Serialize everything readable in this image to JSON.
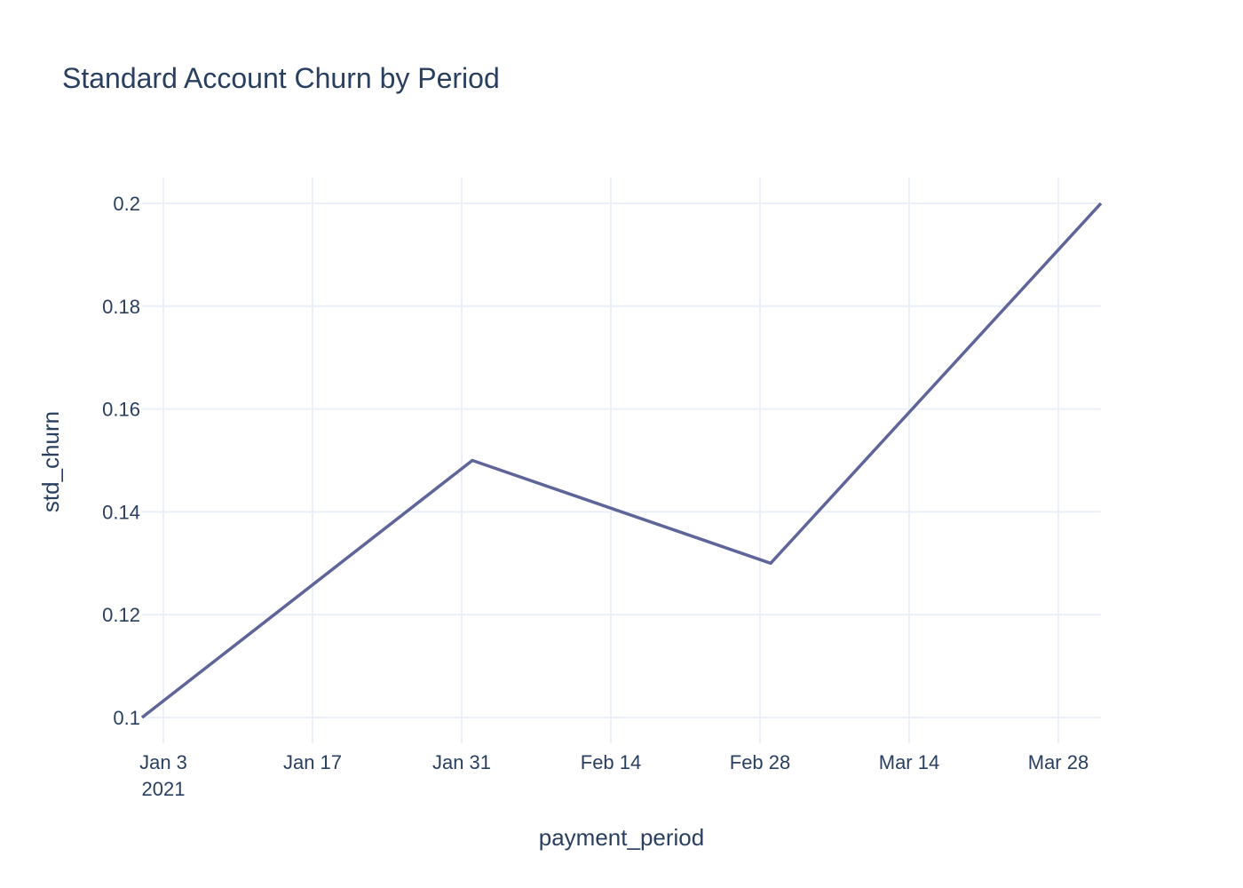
{
  "chart_data": {
    "type": "line",
    "title": "Standard Account Churn by Period",
    "xlabel": "payment_period",
    "ylabel": "std_churn",
    "x": [
      "2021-01-01",
      "2021-02-01",
      "2021-03-01",
      "2021-04-01"
    ],
    "series": [
      {
        "values": [
          0.1,
          0.15,
          0.13,
          0.2
        ]
      }
    ],
    "xlim": [
      "2021-01-01",
      "2021-04-01"
    ],
    "ylim": [
      0.095,
      0.205
    ],
    "x_ticks": [
      "2021-01-03",
      "2021-01-17",
      "2021-01-31",
      "2021-02-14",
      "2021-02-28",
      "2021-03-14",
      "2021-03-28"
    ],
    "x_tick_labels": [
      "Jan 3",
      "Jan 17",
      "Jan 31",
      "Feb 14",
      "Feb 28",
      "Mar 14",
      "Mar 28"
    ],
    "x_tick_sublabel": "2021",
    "y_ticks": [
      0.1,
      0.12,
      0.14,
      0.16,
      0.18,
      0.2
    ],
    "y_tick_labels": [
      "0.1",
      "0.12",
      "0.14",
      "0.16",
      "0.18",
      "0.2"
    ],
    "grid": true,
    "line_color": "#636efa",
    "line_color_rendered": "#5f6599"
  }
}
